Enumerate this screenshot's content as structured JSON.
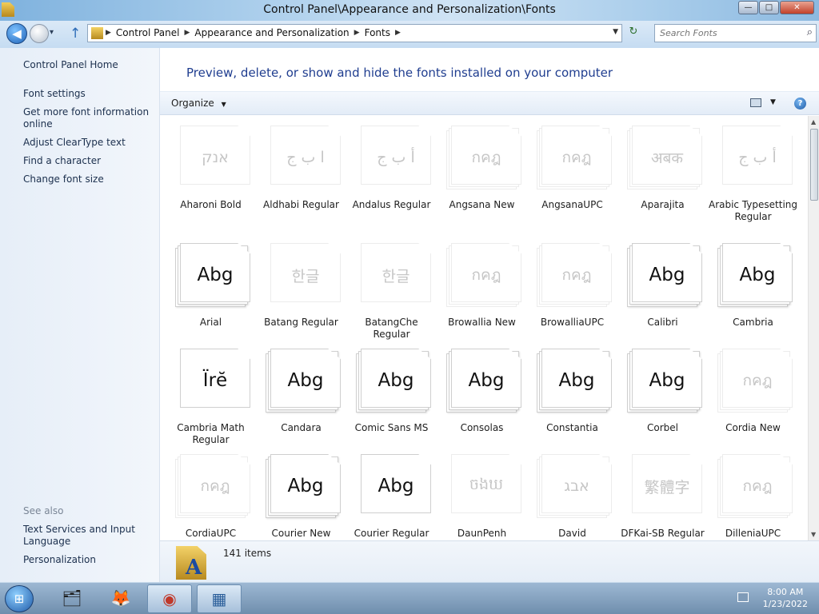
{
  "window": {
    "title": "Control Panel\\Appearance and Personalization\\Fonts",
    "min": "—",
    "max": "□",
    "close": "✕"
  },
  "nav": {
    "back": "◀",
    "forward": "▶",
    "recent": "▾",
    "up": "↑",
    "breadcrumbs": [
      "Control Panel",
      "Appearance and Personalization",
      "Fonts"
    ],
    "crumb_sep": "▶",
    "address_drop": "▼",
    "refresh": "↻",
    "search_placeholder": "Search Fonts"
  },
  "sidebar": {
    "home": "Control Panel Home",
    "links": [
      "Font settings",
      "Get more font information online",
      "Adjust ClearType text",
      "Find a character",
      "Change font size"
    ],
    "see_also_title": "See also",
    "see_also": [
      "Text Services and Input Language",
      "Personalization"
    ]
  },
  "main": {
    "headline": "Preview, delete, or show and hide the fonts installed on your computer",
    "organize": "Organize",
    "organize_drop": "▼",
    "view_drop": "▼",
    "help": "?"
  },
  "fonts": [
    {
      "name": "Aharoni Bold",
      "sample": "אנק",
      "stack": "single",
      "hidden": true
    },
    {
      "name": "Aldhabi Regular",
      "sample": "ا ب ج",
      "stack": "single",
      "hidden": true
    },
    {
      "name": "Andalus Regular",
      "sample": "أ ب ج",
      "stack": "single",
      "hidden": true
    },
    {
      "name": "Angsana New",
      "sample": "กคฎ",
      "stack": "multi",
      "hidden": true
    },
    {
      "name": "AngsanaUPC",
      "sample": "กคฎ",
      "stack": "multi",
      "hidden": true
    },
    {
      "name": "Aparajita",
      "sample": "अबक",
      "stack": "multi",
      "hidden": true
    },
    {
      "name": "Arabic Typesetting Regular",
      "sample": "أ ب ج",
      "stack": "single",
      "hidden": true
    },
    {
      "name": "Arial",
      "sample": "Abg",
      "stack": "multi",
      "hidden": false
    },
    {
      "name": "Batang Regular",
      "sample": "한글",
      "stack": "single",
      "hidden": true
    },
    {
      "name": "BatangChe Regular",
      "sample": "한글",
      "stack": "single",
      "hidden": true
    },
    {
      "name": "Browallia New",
      "sample": "กคฎ",
      "stack": "multi",
      "hidden": true
    },
    {
      "name": "BrowalliaUPC",
      "sample": "กคฎ",
      "stack": "multi",
      "hidden": true
    },
    {
      "name": "Calibri",
      "sample": "Abg",
      "stack": "multi",
      "hidden": false
    },
    {
      "name": "Cambria",
      "sample": "Abg",
      "stack": "multi",
      "hidden": false
    },
    {
      "name": "Cambria Math Regular",
      "sample": "Ïrĕ",
      "stack": "single",
      "hidden": false
    },
    {
      "name": "Candara",
      "sample": "Abg",
      "stack": "multi",
      "hidden": false
    },
    {
      "name": "Comic Sans MS",
      "sample": "Abg",
      "stack": "multi",
      "hidden": false
    },
    {
      "name": "Consolas",
      "sample": "Abg",
      "stack": "multi",
      "hidden": false
    },
    {
      "name": "Constantia",
      "sample": "Abg",
      "stack": "multi",
      "hidden": false
    },
    {
      "name": "Corbel",
      "sample": "Abg",
      "stack": "multi",
      "hidden": false
    },
    {
      "name": "Cordia New",
      "sample": "กคฎ",
      "stack": "multi",
      "hidden": true
    },
    {
      "name": "CordiaUPC",
      "sample": "กคฎ",
      "stack": "multi",
      "hidden": true
    },
    {
      "name": "Courier New",
      "sample": "Abg",
      "stack": "multi",
      "hidden": false
    },
    {
      "name": "Courier Regular",
      "sample": "Abg",
      "stack": "single",
      "hidden": false
    },
    {
      "name": "DaunPenh",
      "sample": "ចងឃ",
      "stack": "single",
      "hidden": true
    },
    {
      "name": "David",
      "sample": "אבג",
      "stack": "multi",
      "hidden": true
    },
    {
      "name": "DFKai-SB Regular",
      "sample": "繁體字",
      "stack": "single",
      "hidden": true
    },
    {
      "name": "DilleniaUPC",
      "sample": "กคฎ",
      "stack": "multi",
      "hidden": true
    }
  ],
  "status": {
    "count": "141 items"
  },
  "taskbar": {
    "start": "⊞",
    "apps": [
      {
        "name": "Windows Explorer",
        "glyph": "🗂"
      },
      {
        "name": "Firefox",
        "glyph": "🦊"
      },
      {
        "name": "Chrome",
        "glyph": "◉"
      },
      {
        "name": "Control Panel",
        "glyph": "▦"
      }
    ],
    "time": "8:00 AM",
    "date": "1/23/2022"
  }
}
